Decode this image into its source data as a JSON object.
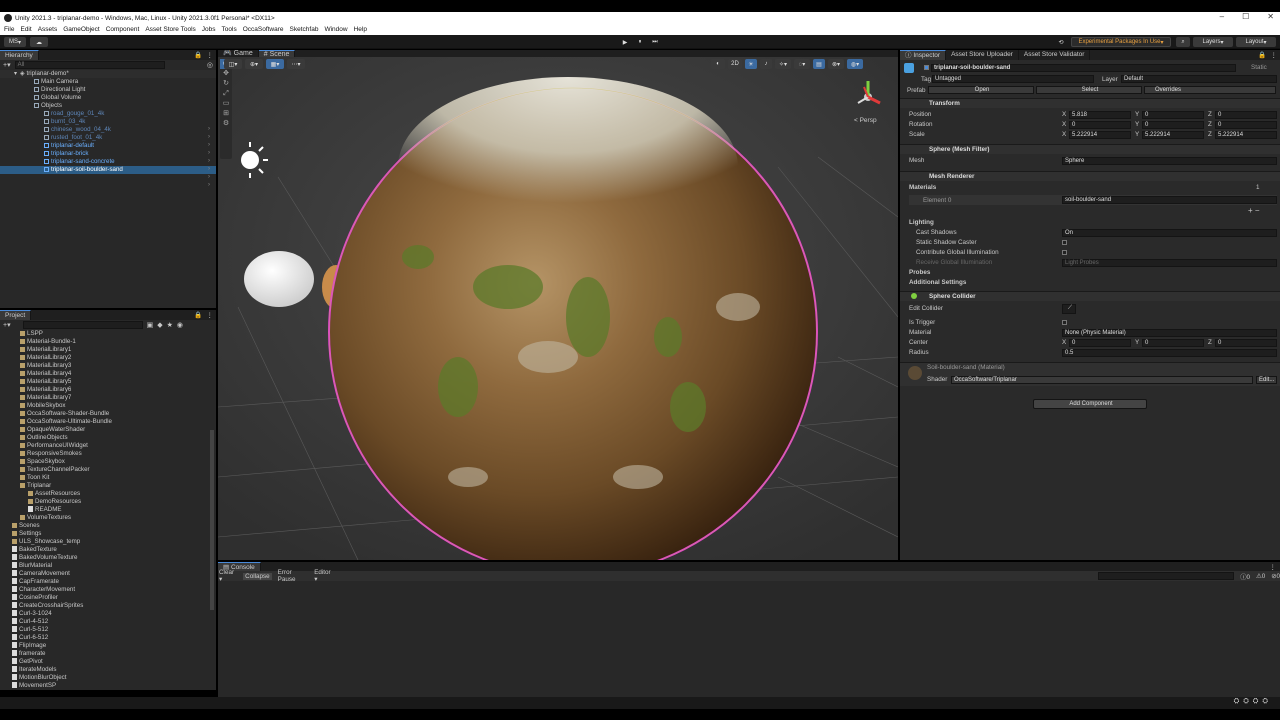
{
  "window": {
    "title": "Unity 2021.3 - triplanar-demo - Windows, Mac, Linux - Unity 2021.3.0f1 Personal* <DX11>",
    "controls": [
      "–",
      "☐",
      "✕"
    ]
  },
  "menu": [
    "File",
    "Edit",
    "Assets",
    "GameObject",
    "Component",
    "Asset Store Tools",
    "Jobs",
    "Tools",
    "OccaSoftware",
    "Sketchfab",
    "Window",
    "Help"
  ],
  "toolbar": {
    "account": "MS",
    "experimental": "Experimental Packages In Use",
    "layers": "Layers",
    "layout": "Layout",
    "play": "▶",
    "pause": "⏸",
    "step": "⏭"
  },
  "hierarchy": {
    "tab": "Hierarchy",
    "search_placeholder": "All",
    "scene": "triplanar-demo*",
    "items": [
      {
        "label": "Main Camera",
        "depth": 2,
        "style": "n"
      },
      {
        "label": "Directional Light",
        "depth": 2,
        "style": "n"
      },
      {
        "label": "Global Volume",
        "depth": 2,
        "style": "n"
      },
      {
        "label": "Objects",
        "depth": 2,
        "style": "n"
      },
      {
        "label": "road_gouge_01_4k",
        "depth": 3,
        "style": "dim"
      },
      {
        "label": "burnt_03_4k",
        "depth": 3,
        "style": "dim"
      },
      {
        "label": "chinese_wood_04_4k",
        "depth": 3,
        "style": "dim"
      },
      {
        "label": "rusted_foot_01_4k",
        "depth": 3,
        "style": "dim"
      },
      {
        "label": "triplanar-default",
        "depth": 3,
        "style": "hl"
      },
      {
        "label": "triplanar-brick",
        "depth": 3,
        "style": "hl"
      },
      {
        "label": "triplanar-sand-concrete",
        "depth": 3,
        "style": "hl"
      },
      {
        "label": "triplanar-soil-boulder-sand",
        "depth": 3,
        "style": "sel"
      }
    ]
  },
  "project": {
    "tab": "Project",
    "items": [
      {
        "label": "LSPP",
        "t": "f",
        "d": 2
      },
      {
        "label": "Material-Bundle-1",
        "t": "f",
        "d": 2
      },
      {
        "label": "MaterialLibrary1",
        "t": "f",
        "d": 2
      },
      {
        "label": "MaterialLibrary2",
        "t": "f",
        "d": 2
      },
      {
        "label": "MaterialLibrary3",
        "t": "f",
        "d": 2
      },
      {
        "label": "MaterialLibrary4",
        "t": "f",
        "d": 2
      },
      {
        "label": "MaterialLibrary5",
        "t": "f",
        "d": 2
      },
      {
        "label": "MaterialLibrary6",
        "t": "f",
        "d": 2
      },
      {
        "label": "MaterialLibrary7",
        "t": "f",
        "d": 2
      },
      {
        "label": "MobileSkybox",
        "t": "f",
        "d": 2
      },
      {
        "label": "OccaSoftware-Shader-Bundle",
        "t": "f",
        "d": 2
      },
      {
        "label": "OccaSoftware-Ultimate-Bundle",
        "t": "f",
        "d": 2
      },
      {
        "label": "OpaqueWaterShader",
        "t": "f",
        "d": 2
      },
      {
        "label": "OutlineObjects",
        "t": "f",
        "d": 2
      },
      {
        "label": "PerformanceUIWidget",
        "t": "f",
        "d": 2
      },
      {
        "label": "ResponsiveSmokes",
        "t": "f",
        "d": 2
      },
      {
        "label": "SpaceSkybox",
        "t": "f",
        "d": 2
      },
      {
        "label": "TextureChannelPacker",
        "t": "f",
        "d": 2
      },
      {
        "label": "Toon Kit",
        "t": "f",
        "d": 2
      },
      {
        "label": "Triplanar",
        "t": "f",
        "d": 2
      },
      {
        "label": "AssetResources",
        "t": "f",
        "d": 3
      },
      {
        "label": "DemoResources",
        "t": "f",
        "d": 3
      },
      {
        "label": "README",
        "t": "d",
        "d": 3
      },
      {
        "label": "VolumeTextures",
        "t": "f",
        "d": 2
      },
      {
        "label": "Scenes",
        "t": "f",
        "d": 1
      },
      {
        "label": "Settings",
        "t": "f",
        "d": 1
      },
      {
        "label": "ULS_Showcase_temp",
        "t": "f",
        "d": 1
      },
      {
        "label": "BakedTexture",
        "t": "d",
        "d": 1
      },
      {
        "label": "BakedVolumeTexture",
        "t": "d",
        "d": 1
      },
      {
        "label": "BlurMaterial",
        "t": "d",
        "d": 1
      },
      {
        "label": "CameraMovement",
        "t": "d",
        "d": 1
      },
      {
        "label": "CapFramerate",
        "t": "d",
        "d": 1
      },
      {
        "label": "CharacterMovement",
        "t": "d",
        "d": 1
      },
      {
        "label": "CosineProfiler",
        "t": "d",
        "d": 1
      },
      {
        "label": "CreateCrosshairSprites",
        "t": "d",
        "d": 1
      },
      {
        "label": "Curl-3-1024",
        "t": "d",
        "d": 1
      },
      {
        "label": "Curl-4-512",
        "t": "d",
        "d": 1
      },
      {
        "label": "Curl-5-512",
        "t": "d",
        "d": 1
      },
      {
        "label": "Curl-6-512",
        "t": "d",
        "d": 1
      },
      {
        "label": "FlipImage",
        "t": "d",
        "d": 1
      },
      {
        "label": "framerate",
        "t": "d",
        "d": 1
      },
      {
        "label": "GetPivot",
        "t": "d",
        "d": 1
      },
      {
        "label": "IterateModels",
        "t": "d",
        "d": 1
      },
      {
        "label": "MotionBlurObject",
        "t": "d",
        "d": 1
      },
      {
        "label": "MovementSP",
        "t": "d",
        "d": 1
      }
    ]
  },
  "scene": {
    "tabs": [
      "Game",
      "Scene"
    ],
    "mode_2d": "2D",
    "persp": "< Persp"
  },
  "console": {
    "tab": "Console",
    "buttons": [
      "Clear",
      "Collapse",
      "Error Pause",
      "Editor"
    ],
    "counts": [
      "0",
      "0",
      "0"
    ]
  },
  "inspector": {
    "tabs": [
      "Inspector",
      "Asset Store Uploader",
      "Asset Store Validator"
    ],
    "object_name": "triplanar-soil-boulder-sand",
    "static": "Static",
    "tag_label": "Tag",
    "tag": "Untagged",
    "layer_label": "Layer",
    "layer": "Default",
    "prefab_label": "Prefab",
    "prefab_open": "Open",
    "prefab_select": "Select",
    "prefab_overrides": "Overrides",
    "transform": {
      "title": "Transform",
      "position_label": "Position",
      "rotation_label": "Rotation",
      "scale_label": "Scale",
      "position": [
        "5.818",
        "0",
        "0"
      ],
      "rotation": [
        "0",
        "0",
        "0"
      ],
      "scale": [
        "5.222914",
        "5.222914",
        "5.222914"
      ]
    },
    "mesh_filter": {
      "title": "Sphere (Mesh Filter)",
      "mesh_label": "Mesh",
      "mesh": "Sphere"
    },
    "mesh_renderer": {
      "title": "Mesh Renderer",
      "materials_label": "Materials",
      "materials_count": "1",
      "element_label": "Element 0",
      "element_value": "soil-boulder-sand",
      "lighting_label": "Lighting",
      "cast_shadows_label": "Cast Shadows",
      "cast_shadows": "On",
      "static_caster_label": "Static Shadow Caster",
      "contribute_gi_label": "Contribute Global Illumination",
      "receive_gi_label": "Receive Global Illumination",
      "receive_gi": "Light Probes",
      "probes_label": "Probes",
      "additional_label": "Additional Settings"
    },
    "sphere_collider": {
      "title": "Sphere Collider",
      "edit_collider_label": "Edit Collider",
      "is_trigger_label": "Is Trigger",
      "material_label": "Material",
      "material": "None (Physic Material)",
      "center_label": "Center",
      "center": [
        "0",
        "0",
        "0"
      ],
      "radius_label": "Radius",
      "radius": "0.5"
    },
    "material": {
      "title": "Soil-boulder-sand (Material)",
      "shader_label": "Shader",
      "shader": "OccaSoftware/Triplanar",
      "edit": "Edit..."
    },
    "add_component": "Add Component"
  },
  "colors": {
    "selection": "#2c5d87",
    "highlight_outline": "#e040d0",
    "accent": "#4a8ad8",
    "prefab_text": "#6ab0ff"
  }
}
